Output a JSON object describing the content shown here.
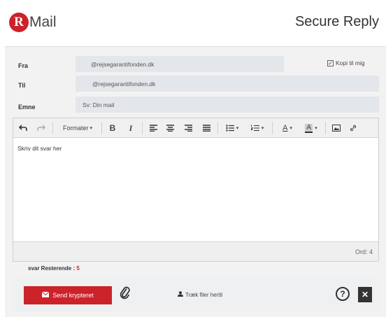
{
  "header": {
    "logo_letter": "R",
    "logo_text": "Mail",
    "title": "Secure Reply",
    "brand_color": "#cc2229"
  },
  "form": {
    "from_label": "Fra",
    "from_value": "@rejsegarantifonden.dk",
    "copy_label": "Kopi til mig",
    "copy_checked": true,
    "to_label": "Til",
    "to_value": "@rejsegarantifonden.dk",
    "subject_label": "Emne",
    "subject_value": "Sv: Din mail"
  },
  "toolbar": {
    "format_label": "Formater",
    "bold": "B",
    "italic": "I",
    "icons": [
      "undo-icon",
      "redo-icon",
      "align-left-icon",
      "align-center-icon",
      "align-right-icon",
      "align-justify-icon",
      "bullet-list-icon",
      "numbered-list-icon",
      "text-color-icon",
      "background-color-icon",
      "image-icon",
      "link-icon"
    ]
  },
  "editor": {
    "body_text": "Skriv dit svar her",
    "word_count": "Ord: 4"
  },
  "remaining": {
    "label": "svar Resterende :",
    "value": "5"
  },
  "footer": {
    "send_label": "Send krypteret",
    "drop_label": "Træk filer hertil"
  }
}
